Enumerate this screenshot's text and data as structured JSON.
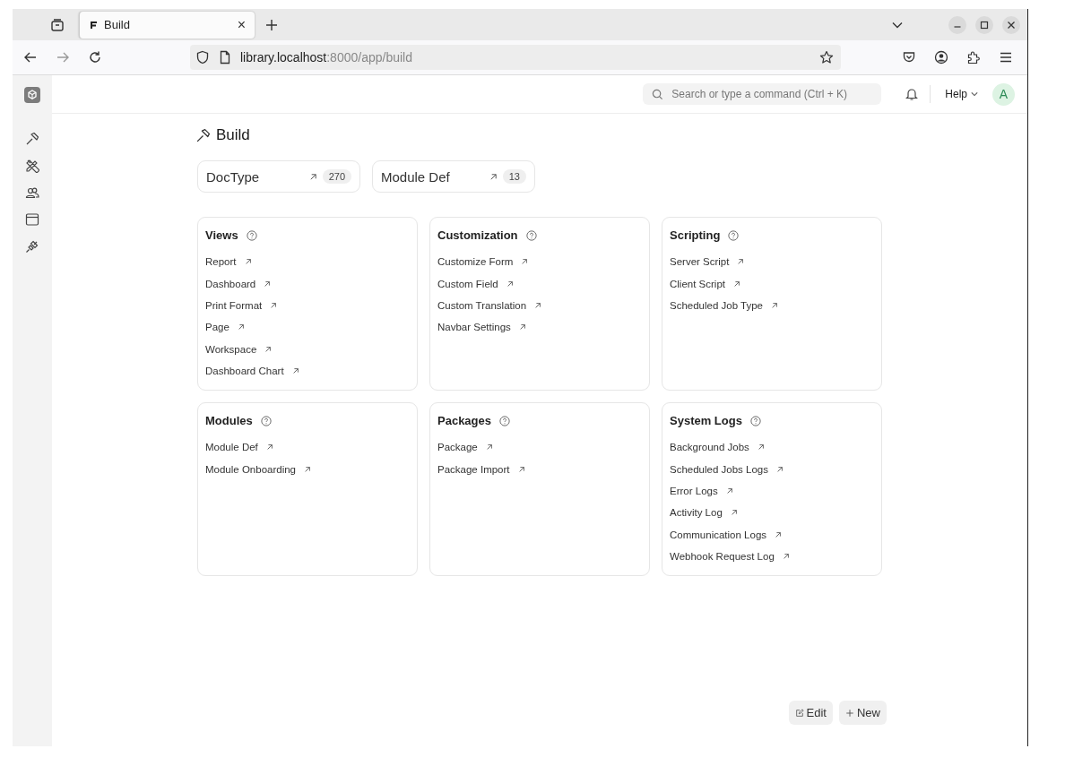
{
  "browser": {
    "tab": {
      "title": "Build",
      "close": "×"
    },
    "url_host": "library.localhost",
    "url_rest": ":8000/app/build"
  },
  "topbar": {
    "search": {
      "placeholder": "Search or type a command (Ctrl + K)"
    },
    "help": "Help",
    "avatar": "A"
  },
  "page": {
    "title": "Build"
  },
  "shortcuts": [
    {
      "label": "DocType",
      "count": "270"
    },
    {
      "label": "Module Def",
      "count": "13"
    }
  ],
  "cards": [
    {
      "title": "Views",
      "links": [
        "Report",
        "Dashboard",
        "Print Format",
        "Page",
        "Workspace",
        "Dashboard Chart"
      ]
    },
    {
      "title": "Customization",
      "links": [
        "Customize Form",
        "Custom Field",
        "Custom Translation",
        "Navbar Settings"
      ]
    },
    {
      "title": "Scripting",
      "links": [
        "Server Script",
        "Client Script",
        "Scheduled Job Type"
      ]
    },
    {
      "title": "Modules",
      "links": [
        "Module Def",
        "Module Onboarding"
      ]
    },
    {
      "title": "Packages",
      "links": [
        "Package",
        "Package Import"
      ]
    },
    {
      "title": "System Logs",
      "links": [
        "Background Jobs",
        "Scheduled Jobs Logs",
        "Error Logs",
        "Activity Log",
        "Communication Logs",
        "Webhook Request Log"
      ]
    }
  ],
  "buttons": [
    {
      "kind": "edit",
      "label": "Edit"
    },
    {
      "kind": "new",
      "label": "New"
    }
  ]
}
